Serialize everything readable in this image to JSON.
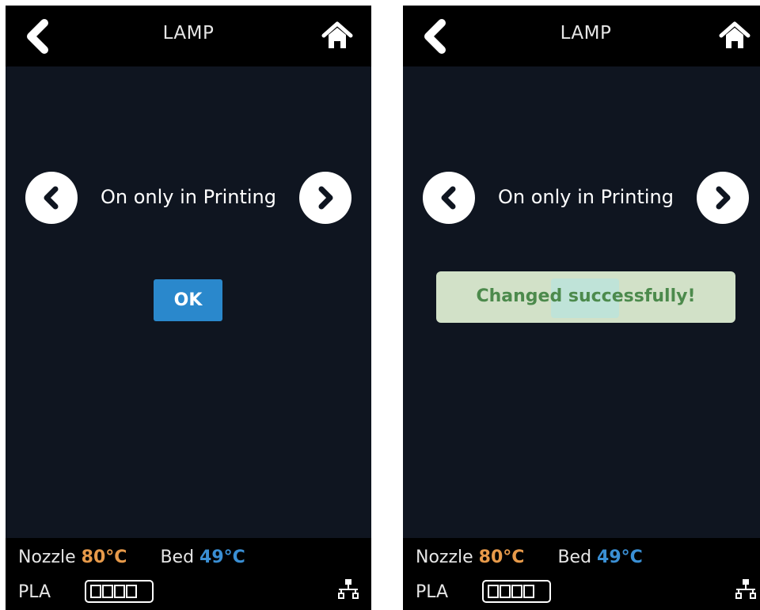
{
  "screens": [
    {
      "header": {
        "title": "LAMP",
        "back_icon": "chevron-left-icon",
        "home_icon": "home-icon"
      },
      "selector": {
        "value": "On only in Printing",
        "prev_icon": "chevron-left-icon",
        "next_icon": "chevron-right-icon"
      },
      "ok_label": "OK",
      "status": {
        "nozzle_label": "Nozzle",
        "nozzle_temp": "80°C",
        "bed_label": "Bed",
        "bed_temp": "49°C",
        "material": "PLA",
        "filament_level": 1.0,
        "network_icon": "network-icon"
      }
    },
    {
      "header": {
        "title": "LAMP",
        "back_icon": "chevron-left-icon",
        "home_icon": "home-icon"
      },
      "selector": {
        "value": "On only in Printing",
        "prev_icon": "chevron-left-icon",
        "next_icon": "chevron-right-icon"
      },
      "toast": "Changed successfully!",
      "status": {
        "nozzle_label": "Nozzle",
        "nozzle_temp": "80°C",
        "bed_label": "Bed",
        "bed_temp": "49°C",
        "material": "PLA",
        "filament_level": 1.0,
        "network_icon": "network-icon"
      }
    }
  ],
  "colors": {
    "screen_bg": "#0f1520",
    "bar_bg": "#000000",
    "ok_button": "#2a88cc",
    "nozzle_temp": "#e79a4a",
    "bed_temp": "#3a8fd4",
    "toast_bg": "#d2e1c8",
    "toast_text": "#4c8a4c"
  }
}
